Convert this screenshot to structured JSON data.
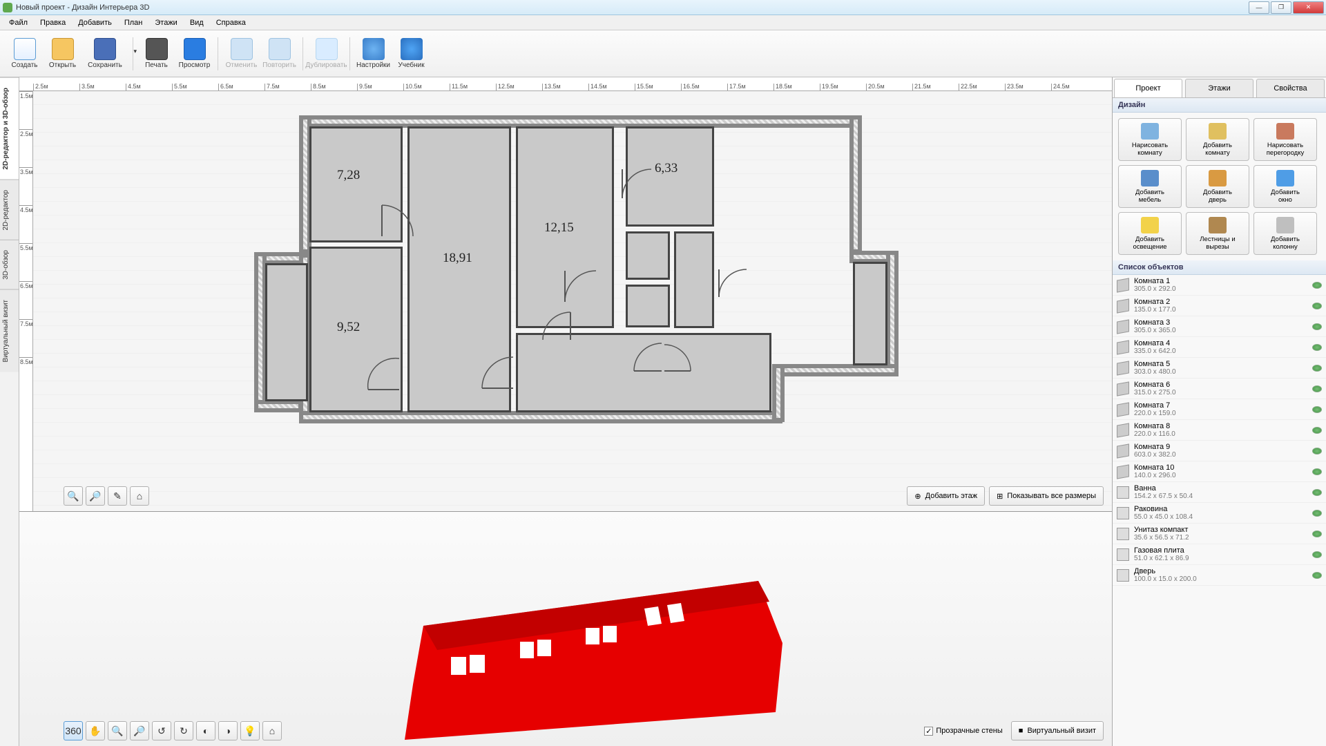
{
  "window": {
    "title": "Новый проект - Дизайн Интерьера 3D"
  },
  "menu": [
    "Файл",
    "Правка",
    "Добавить",
    "План",
    "Этажи",
    "Вид",
    "Справка"
  ],
  "toolbar": [
    {
      "id": "new",
      "label": "Создать"
    },
    {
      "id": "open",
      "label": "Открыть"
    },
    {
      "id": "save",
      "label": "Сохранить"
    },
    {
      "sep": true
    },
    {
      "id": "print",
      "label": "Печать"
    },
    {
      "id": "preview",
      "label": "Просмотр"
    },
    {
      "sep": true
    },
    {
      "id": "undo",
      "label": "Отменить",
      "disabled": true
    },
    {
      "id": "redo",
      "label": "Повторить",
      "disabled": true
    },
    {
      "sep": true
    },
    {
      "id": "dup",
      "label": "Дублировать",
      "disabled": true
    },
    {
      "sep": true
    },
    {
      "id": "settings",
      "label": "Настройки"
    },
    {
      "id": "tutorial",
      "label": "Учебник"
    }
  ],
  "side_tabs": [
    "2D-редактор и 3D-обзор",
    "2D-редактор",
    "3D-обзор",
    "Виртуальный визит"
  ],
  "ruler_h": [
    "2.5м",
    "3.5м",
    "4.5м",
    "5.5м",
    "6.5м",
    "7.5м",
    "8.5м",
    "9.5м",
    "10.5м",
    "11.5м",
    "12.5м",
    "13.5м",
    "14.5м",
    "15.5м",
    "16.5м",
    "17.5м",
    "18.5м",
    "19.5м",
    "20.5м",
    "21.5м",
    "22.5м",
    "23.5м",
    "24.5м"
  ],
  "ruler_v": [
    "1.5м",
    "2.5м",
    "3.5м",
    "4.5м",
    "5.5м",
    "6.5м",
    "7.5м",
    "8.5м"
  ],
  "rooms": {
    "r1": "7,28",
    "r2": "18,91",
    "r3": "12,15",
    "r4": "6,33",
    "r5": "9,52"
  },
  "plan_buttons": {
    "add_floor": "Добавить этаж",
    "show_dims": "Показывать все размеры"
  },
  "view3d_right": {
    "transparent": "Прозрачные стены",
    "virtual": "Виртуальный визит"
  },
  "right_tabs": [
    "Проект",
    "Этажи",
    "Свойства"
  ],
  "sections": {
    "design": "Дизайн",
    "objects": "Список объектов"
  },
  "design_buttons": [
    {
      "l1": "Нарисовать",
      "l2": "комнату",
      "c": "#7fb3e0"
    },
    {
      "l1": "Добавить",
      "l2": "комнату",
      "c": "#e0c060"
    },
    {
      "l1": "Нарисовать",
      "l2": "перегородку",
      "c": "#c97a5e"
    },
    {
      "l1": "Добавить",
      "l2": "мебель",
      "c": "#5a8ecb"
    },
    {
      "l1": "Добавить",
      "l2": "дверь",
      "c": "#d99a42"
    },
    {
      "l1": "Добавить",
      "l2": "окно",
      "c": "#4f9de6"
    },
    {
      "l1": "Добавить",
      "l2": "освещение",
      "c": "#f2d24a"
    },
    {
      "l1": "Лестницы и",
      "l2": "вырезы",
      "c": "#b08850"
    },
    {
      "l1": "Добавить",
      "l2": "колонну",
      "c": "#bfbfbf"
    }
  ],
  "objects": [
    {
      "name": "Комната 1",
      "dim": "305.0 x 292.0",
      "ico": "room"
    },
    {
      "name": "Комната 2",
      "dim": "135.0 x 177.0",
      "ico": "room"
    },
    {
      "name": "Комната 3",
      "dim": "305.0 x 365.0",
      "ico": "room"
    },
    {
      "name": "Комната 4",
      "dim": "335.0 x 642.0",
      "ico": "room"
    },
    {
      "name": "Комната 5",
      "dim": "303.0 x 480.0",
      "ico": "room"
    },
    {
      "name": "Комната 6",
      "dim": "315.0 x 275.0",
      "ico": "room"
    },
    {
      "name": "Комната 7",
      "dim": "220.0 x 159.0",
      "ico": "room"
    },
    {
      "name": "Комната 8",
      "dim": "220.0 x 116.0",
      "ico": "room"
    },
    {
      "name": "Комната 9",
      "dim": "603.0 x 382.0",
      "ico": "room"
    },
    {
      "name": "Комната 10",
      "dim": "140.0 x 296.0",
      "ico": "room"
    },
    {
      "name": "Ванна",
      "dim": "154.2 x 67.5 x 50.4",
      "ico": "bath"
    },
    {
      "name": "Раковина",
      "dim": "55.0 x 45.0 x 108.4",
      "ico": "sink"
    },
    {
      "name": "Унитаз компакт",
      "dim": "35.6 x 56.5 x 71.2",
      "ico": "toilet"
    },
    {
      "name": "Газовая плита",
      "dim": "51.0 x 62.1 x 86.9",
      "ico": "stove"
    },
    {
      "name": "Дверь",
      "dim": "100.0 x 15.0 x 200.0",
      "ico": "door"
    }
  ]
}
